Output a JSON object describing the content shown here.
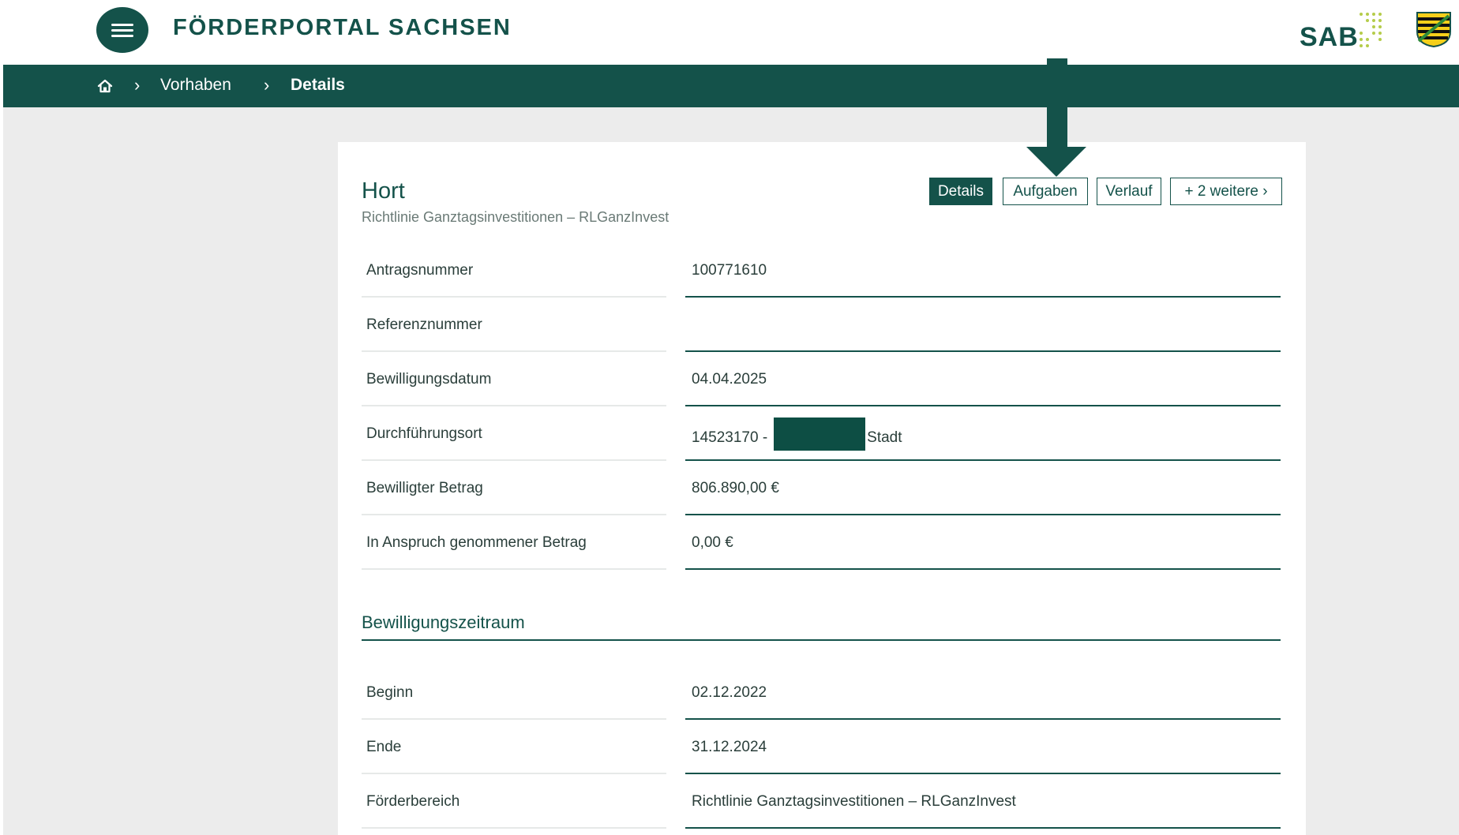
{
  "header": {
    "portal_title": "FÖRDERPORTAL SACHSEN",
    "sab_logo_text": "SAB"
  },
  "breadcrumb": {
    "home_icon": "home-icon",
    "items": [
      "Vorhaben",
      "Details"
    ],
    "separator": "›"
  },
  "project": {
    "title": "Hort",
    "subtitle": "Richtlinie Ganztagsinvestitionen – RLGanzInvest"
  },
  "tabs": [
    {
      "label": "Details",
      "active": true
    },
    {
      "label": "Aufgaben",
      "active": false
    },
    {
      "label": "Verlauf",
      "active": false
    },
    {
      "label": "+ 2 weitere ›",
      "active": false
    }
  ],
  "details": [
    {
      "label": "Antragsnummer",
      "value": "100771610"
    },
    {
      "label": "Referenznummer",
      "value": ""
    },
    {
      "label": "Bewilligungsdatum",
      "value": "04.04.2025"
    },
    {
      "label": "Durchführungsort",
      "value_prefix": "14523170 -",
      "value_suffix": "Stadt"
    },
    {
      "label": "Bewilligter Betrag",
      "value": "806.890,00 €"
    },
    {
      "label": "In Anspruch genommener Betrag",
      "value": "0,00 €"
    }
  ],
  "period_section": {
    "title": "Bewilligungszeitraum",
    "rows": [
      {
        "label": "Beginn",
        "value": "02.12.2022"
      },
      {
        "label": "Ende",
        "value": "31.12.2024"
      },
      {
        "label": "Förderbereich",
        "value": "Richtlinie Ganztagsinvestitionen – RLGanzInvest"
      }
    ]
  },
  "colors": {
    "primary": "#14524a",
    "background": "#ececec",
    "accent_dots": "#b5cc4a"
  }
}
